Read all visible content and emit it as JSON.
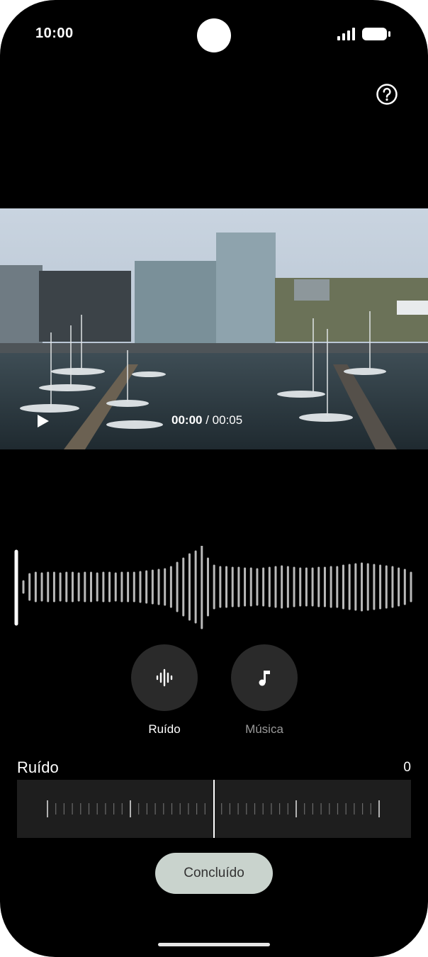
{
  "status_bar": {
    "time": "10:00"
  },
  "video": {
    "current_time": "00:00",
    "separator": " / ",
    "duration": "00:05"
  },
  "modes": [
    {
      "label": "Ruído",
      "icon": "waveform-icon",
      "active": true
    },
    {
      "label": "Música",
      "icon": "music-note-icon",
      "active": false
    }
  ],
  "noise": {
    "title": "Ruído",
    "value": "0"
  },
  "done_button": {
    "label": "Concluído"
  },
  "colors": {
    "background": "#000000",
    "button_circle": "#2a2a2a",
    "done_button": "#c9d3cd",
    "inactive_label": "#9a9a9a"
  }
}
